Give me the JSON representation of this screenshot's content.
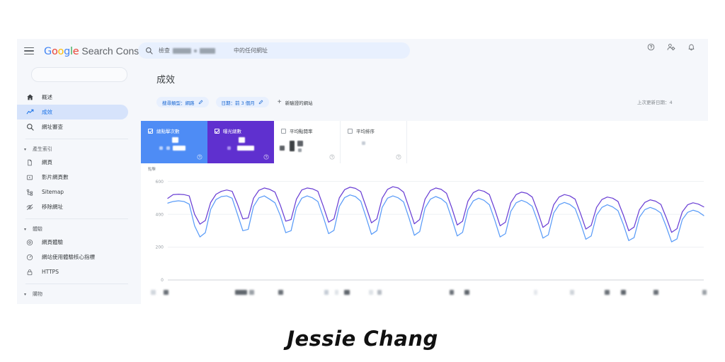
{
  "app": {
    "brand_google_letters": [
      "G",
      "o",
      "o",
      "g",
      "l",
      "e"
    ],
    "brand_suffix": "Search Console",
    "hamburger": "menu"
  },
  "search": {
    "prefix": "檢查",
    "suffix": "中的任何網址",
    "redacted_domain": "[redacted]"
  },
  "header_icons": [
    {
      "name": "help-icon",
      "label": "說明"
    },
    {
      "name": "account-settings-icon",
      "label": "帳戶設定"
    },
    {
      "name": "notifications-icon",
      "label": "通知"
    }
  ],
  "sidebar": {
    "search_placeholder": "",
    "items": [
      {
        "label": "概述",
        "icon": "home-icon",
        "active": false
      },
      {
        "label": "成效",
        "icon": "trending-up-icon",
        "active": true
      },
      {
        "label": "網址審查",
        "icon": "search-icon",
        "active": false
      }
    ],
    "groups": [
      {
        "label": "產生索引",
        "items": [
          {
            "label": "網頁",
            "icon": "page-icon"
          },
          {
            "label": "影片網頁數",
            "icon": "video-icon"
          },
          {
            "label": "Sitemap",
            "icon": "sitemap-icon"
          },
          {
            "label": "移除網址",
            "icon": "eye-off-icon"
          }
        ]
      },
      {
        "label": "體驗",
        "items": [
          {
            "label": "網頁體驗",
            "icon": "gauge-icon"
          },
          {
            "label": "網站使用體驗核心指標",
            "icon": "speed-icon"
          },
          {
            "label": "HTTPS",
            "icon": "lock-icon"
          }
        ]
      },
      {
        "label": "購物",
        "items": []
      }
    ]
  },
  "main": {
    "page_title": "成效",
    "filters": [
      {
        "name": "search-type-filter",
        "label": "搜尋類型：網路"
      },
      {
        "name": "date-filter",
        "label": "日期：前 3 個月"
      }
    ],
    "add_site_label": "新驗證的網站",
    "last_update": "上次更新日期：4"
  },
  "metric_cards": [
    {
      "name": "total-clicks-card",
      "label": "總點擊次數",
      "checked": true,
      "color": "#4e8cf5",
      "value_redacted": true
    },
    {
      "name": "total-impressions-card",
      "label": "曝光總數",
      "checked": true,
      "color": "#5f30cf",
      "value_redacted": true
    },
    {
      "name": "average-ctr-card",
      "label": "平均點閱率",
      "checked": false,
      "color": "#ffffff",
      "value_redacted": true
    },
    {
      "name": "average-position-card",
      "label": "平均排序",
      "checked": false,
      "color": "#ffffff",
      "value_redacted": true
    }
  ],
  "chart_data": {
    "type": "line",
    "title": "",
    "ylabel": "點擊",
    "xlabel": "",
    "ylim": [
      0,
      650
    ],
    "yticks": [
      0,
      200,
      400,
      600
    ],
    "grid": true,
    "legend_position": "none",
    "xtick_labels_redacted": true,
    "series": [
      {
        "name": "曝光總數",
        "color": "#6a3fd4",
        "values": [
          497,
          520,
          522,
          520,
          512,
          400,
          340,
          362,
          472,
          522,
          540,
          548,
          540,
          462,
          372,
          378,
          498,
          546,
          560,
          552,
          535,
          455,
          358,
          368,
          492,
          548,
          560,
          555,
          540,
          450,
          352,
          372,
          500,
          550,
          565,
          558,
          538,
          445,
          348,
          372,
          498,
          552,
          568,
          560,
          535,
          440,
          342,
          368,
          492,
          545,
          560,
          552,
          528,
          438,
          335,
          358,
          480,
          532,
          548,
          540,
          520,
          430,
          330,
          352,
          470,
          520,
          535,
          528,
          505,
          418,
          320,
          345,
          458,
          505,
          520,
          512,
          492,
          405,
          310,
          332,
          442,
          490,
          505,
          498,
          478,
          395,
          300,
          322,
          428,
          472,
          488,
          480,
          460,
          380,
          290,
          312,
          415,
          458,
          470,
          462,
          445
        ]
      },
      {
        "name": "總點擊次數",
        "color": "#5a9cf8",
        "values": [
          468,
          478,
          482,
          478,
          462,
          330,
          262,
          288,
          430,
          490,
          508,
          512,
          498,
          400,
          300,
          308,
          448,
          500,
          512,
          492,
          470,
          392,
          288,
          300,
          440,
          498,
          512,
          500,
          478,
          385,
          282,
          302,
          448,
          502,
          518,
          508,
          480,
          382,
          278,
          300,
          442,
          498,
          512,
          500,
          475,
          378,
          272,
          295,
          438,
          492,
          508,
          495,
          468,
          372,
          268,
          290,
          428,
          482,
          498,
          485,
          458,
          365,
          262,
          282,
          418,
          470,
          485,
          472,
          448,
          358,
          255,
          275,
          408,
          458,
          472,
          460,
          435,
          348,
          248,
          268,
          395,
          442,
          458,
          445,
          422,
          338,
          240,
          258,
          382,
          428,
          442,
          430,
          408,
          325,
          232,
          250,
          368,
          412,
          425,
          415,
          392
        ]
      }
    ]
  },
  "footer": {
    "name": "Jessie Chang"
  }
}
